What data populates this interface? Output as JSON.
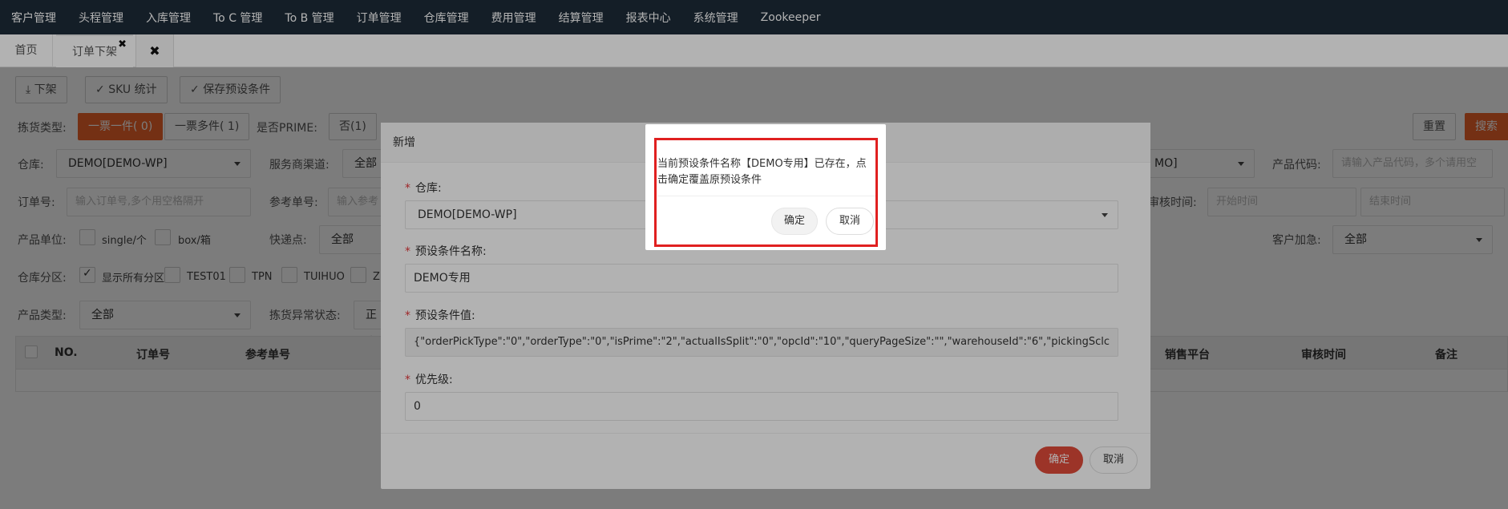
{
  "topnav": {
    "items": [
      "客户管理",
      "头程管理",
      "入库管理",
      "To C 管理",
      "To B 管理",
      "订单管理",
      "仓库管理",
      "费用管理",
      "结算管理",
      "报表中心",
      "系统管理",
      "Zookeeper"
    ]
  },
  "tabs": {
    "home": "首页",
    "active": "订单下架",
    "close_symbol": "✖"
  },
  "toolbar": {
    "unshelve": "下架",
    "sku_stats": "SKU 统计",
    "save_preset": "保存预设条件",
    "reset": "重置",
    "search": "搜索"
  },
  "filters": {
    "pick_type_label": "拣货类型:",
    "single_piece": "一票一件( 0)",
    "multi_piece": "一票多件( 1)",
    "is_prime_label": "是否PRIME:",
    "prime_no": "否(1)",
    "warehouse_label": "仓库:",
    "warehouse_value": "DEMO[DEMO-WP]",
    "service_channel_label": "服务商渠道:",
    "service_channel_value": "全部",
    "right_select_value": "MO]",
    "product_code_label": "产品代码:",
    "product_code_placeholder": "请输入产品代码，多个请用空",
    "order_no_label": "订单号:",
    "order_no_placeholder": "输入订单号,多个用空格隔开",
    "ref_no_label": "参考单号:",
    "ref_no_placeholder": "输入参考",
    "audit_time_label": "审核时间:",
    "start_time_placeholder": "开始时间",
    "end_time_placeholder": "结束时间",
    "product_unit_label": "产品单位:",
    "unit_single": "single/个",
    "unit_box": "box/箱",
    "express_label": "快递点:",
    "express_value": "全部",
    "customer_urgent_label": "客户加急:",
    "customer_urgent_value": "全部",
    "warehouse_zone_label": "仓库分区:",
    "zone_all": "显示所有分区",
    "zone_test01": "TEST01",
    "zone_tpn": "TPN",
    "zone_tuihuo": "TUIHUO",
    "zone_z": "Z",
    "product_type_label": "产品类型:",
    "product_type_value": "全部",
    "pick_exception_label": "拣货异常状态:",
    "pick_exception_value": "正常"
  },
  "table": {
    "headers": [
      "NO.",
      "订单号",
      "参考单号",
      "销售平台",
      "审核时间",
      "备注"
    ]
  },
  "modal": {
    "title": "新增",
    "warehouse_label": "仓库:",
    "warehouse_value": "DEMO[DEMO-WP]",
    "preset_name_label": "预设条件名称:",
    "preset_name_value": "DEMO专用",
    "preset_value_label": "预设条件值:",
    "preset_value_value": "{\"orderPickType\":\"0\",\"orderType\":\"0\",\"isPrime\":\"2\",\"actualIsSplit\":\"0\",\"opcId\":\"10\",\"queryPageSize\":\"\",\"warehouseId\":\"6\",\"pickingSclc",
    "priority_label": "优先级:",
    "priority_value": "0",
    "confirm": "确定",
    "cancel": "取消"
  },
  "confirm_dialog": {
    "message": "当前预设条件名称【DEMO专用】已存在，点击确定覆盖原预设条件",
    "confirm": "确定",
    "cancel": "取消"
  }
}
